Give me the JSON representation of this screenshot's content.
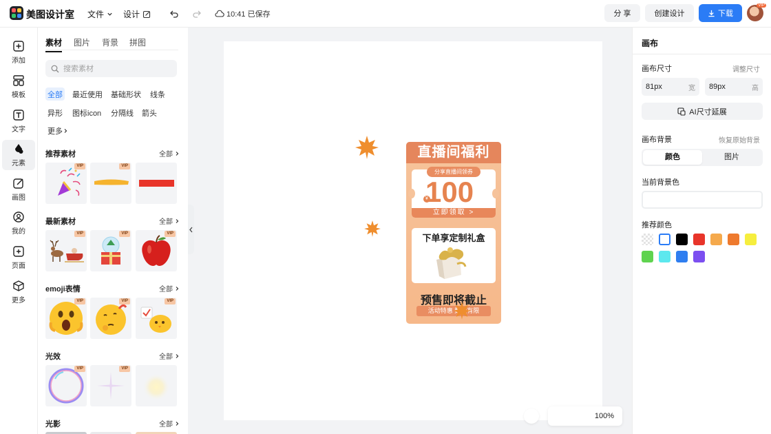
{
  "app": {
    "name": "美图设计室",
    "logo_colors": [
      "#ff5a5f",
      "#ffc83d",
      "#36c46b",
      "#3d8bff"
    ]
  },
  "header": {
    "file_menu": "文件",
    "design_menu": "设计",
    "save_status": "10:41 已保存",
    "share_label": "分 享",
    "create_label": "创建设计",
    "download_label": "下载",
    "avatar_badge": "VIP",
    "accent_color": "#2b7cf6"
  },
  "nav": {
    "items": [
      {
        "label": "添加",
        "icon": "add-square-icon"
      },
      {
        "label": "模板",
        "icon": "template-grid-icon"
      },
      {
        "label": "文字",
        "icon": "text-box-icon"
      },
      {
        "label": "元素",
        "icon": "shapes-icon"
      },
      {
        "label": "画图",
        "icon": "pencil-edit-icon"
      },
      {
        "label": "我的",
        "icon": "user-icon"
      },
      {
        "label": "页面",
        "icon": "page-add-icon"
      },
      {
        "label": "更多",
        "icon": "box-icon"
      }
    ],
    "active_index": 3
  },
  "materials": {
    "tabs": [
      "素材",
      "图片",
      "背景",
      "拼图"
    ],
    "active_tab": "素材",
    "search_placeholder": "搜索素材",
    "chips": [
      "全部",
      "最近使用",
      "基础形状",
      "线条",
      "异形",
      "图标icon",
      "分隔线",
      "箭头",
      "更多"
    ],
    "active_chip": "全部",
    "all_label": "全部",
    "vip_tag": "VIP",
    "sections": [
      {
        "title": "推荐素材",
        "thumbs": [
          "party-popper",
          "yellow-brush-stroke",
          "red-bar"
        ]
      },
      {
        "title": "最新素材",
        "thumbs": [
          "reindeer-sleigh",
          "snow-globe-gift",
          "red-apple"
        ]
      },
      {
        "title": "emoji表情",
        "thumbs": [
          "shocked-emoji",
          "thinking-emoji",
          "chick-emoji"
        ]
      },
      {
        "title": "光效",
        "thumbs": [
          "bubble-ring",
          "sparkle-star",
          "glow-light"
        ]
      },
      {
        "title": "光影",
        "thumbs": []
      }
    ]
  },
  "canvas": {
    "zoom_label": "100%"
  },
  "poster": {
    "header": "直播间福利",
    "share_tag": "分享直播间领券",
    "currency": "¥",
    "amount": "100",
    "claim": "立即领取 >",
    "gift_title": "下单享定制礼盒",
    "presale": "预售即将截止",
    "limit": "活动特惠 数量有限",
    "primary_color": "#e5865c",
    "background_color": "#f6c39b"
  },
  "inspector": {
    "title": "画布",
    "size_label": "画布尺寸",
    "resize_link": "调整尺寸",
    "width_value": "81px",
    "width_unit": "宽",
    "height_value": "89px",
    "height_unit": "高",
    "ai_extend": "AI尺寸延展",
    "background_label": "画布背景",
    "restore_link": "恢复原始背景",
    "bg_options": [
      "颜色",
      "图片"
    ],
    "active_bg_option": "颜色",
    "current_bg_label": "当前背景色",
    "recommended_label": "推荐颜色",
    "swatches": [
      "transparent",
      "#ffffff",
      "#000000",
      "#e8352a",
      "#f5a94c",
      "#ee7a2e",
      "#f6ee3e",
      "#5fd34f",
      "#5ce8ee",
      "#2f7ef0",
      "#7c4ff0"
    ]
  }
}
